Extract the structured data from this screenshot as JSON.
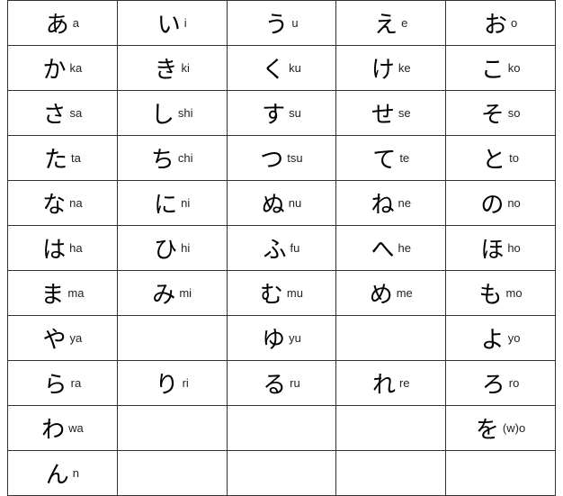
{
  "table": {
    "rows": [
      [
        {
          "kana": "あ",
          "romaji": "a"
        },
        {
          "kana": "い",
          "romaji": "i"
        },
        {
          "kana": "う",
          "romaji": "u"
        },
        {
          "kana": "え",
          "romaji": "e"
        },
        {
          "kana": "お",
          "romaji": "o"
        }
      ],
      [
        {
          "kana": "か",
          "romaji": "ka"
        },
        {
          "kana": "き",
          "romaji": "ki"
        },
        {
          "kana": "く",
          "romaji": "ku"
        },
        {
          "kana": "け",
          "romaji": "ke"
        },
        {
          "kana": "こ",
          "romaji": "ko"
        }
      ],
      [
        {
          "kana": "さ",
          "romaji": "sa"
        },
        {
          "kana": "し",
          "romaji": "shi"
        },
        {
          "kana": "す",
          "romaji": "su"
        },
        {
          "kana": "せ",
          "romaji": "se"
        },
        {
          "kana": "そ",
          "romaji": "so"
        }
      ],
      [
        {
          "kana": "た",
          "romaji": "ta"
        },
        {
          "kana": "ち",
          "romaji": "chi"
        },
        {
          "kana": "つ",
          "romaji": "tsu"
        },
        {
          "kana": "て",
          "romaji": "te"
        },
        {
          "kana": "と",
          "romaji": "to"
        }
      ],
      [
        {
          "kana": "な",
          "romaji": "na"
        },
        {
          "kana": "に",
          "romaji": "ni"
        },
        {
          "kana": "ぬ",
          "romaji": "nu"
        },
        {
          "kana": "ね",
          "romaji": "ne"
        },
        {
          "kana": "の",
          "romaji": "no"
        }
      ],
      [
        {
          "kana": "は",
          "romaji": "ha"
        },
        {
          "kana": "ひ",
          "romaji": "hi"
        },
        {
          "kana": "ふ",
          "romaji": "fu"
        },
        {
          "kana": "へ",
          "romaji": "he"
        },
        {
          "kana": "ほ",
          "romaji": "ho"
        }
      ],
      [
        {
          "kana": "ま",
          "romaji": "ma"
        },
        {
          "kana": "み",
          "romaji": "mi"
        },
        {
          "kana": "む",
          "romaji": "mu"
        },
        {
          "kana": "め",
          "romaji": "me"
        },
        {
          "kana": "も",
          "romaji": "mo"
        }
      ],
      [
        {
          "kana": "や",
          "romaji": "ya"
        },
        {
          "kana": "",
          "romaji": ""
        },
        {
          "kana": "ゆ",
          "romaji": "yu"
        },
        {
          "kana": "",
          "romaji": ""
        },
        {
          "kana": "よ",
          "romaji": "yo"
        }
      ],
      [
        {
          "kana": "ら",
          "romaji": "ra"
        },
        {
          "kana": "り",
          "romaji": "ri"
        },
        {
          "kana": "る",
          "romaji": "ru"
        },
        {
          "kana": "れ",
          "romaji": "re"
        },
        {
          "kana": "ろ",
          "romaji": "ro"
        }
      ],
      [
        {
          "kana": "わ",
          "romaji": "wa"
        },
        {
          "kana": "",
          "romaji": ""
        },
        {
          "kana": "",
          "romaji": ""
        },
        {
          "kana": "",
          "romaji": ""
        },
        {
          "kana": "を",
          "romaji": "(w)o"
        }
      ],
      [
        {
          "kana": "ん",
          "romaji": "n"
        },
        {
          "kana": "",
          "romaji": ""
        },
        {
          "kana": "",
          "romaji": ""
        },
        {
          "kana": "",
          "romaji": ""
        },
        {
          "kana": "",
          "romaji": ""
        }
      ]
    ]
  }
}
